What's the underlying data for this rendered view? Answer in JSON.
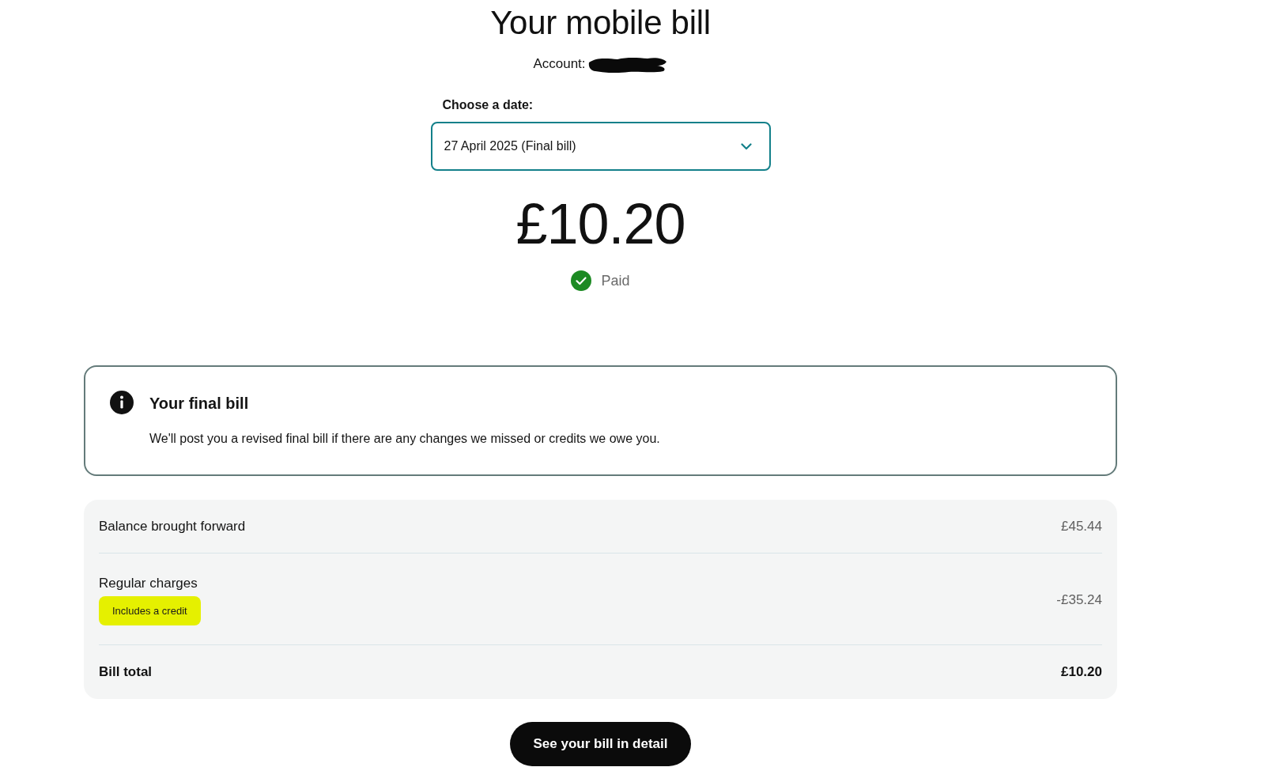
{
  "header": {
    "title": "Your mobile bill",
    "account_label": "Account:",
    "account_redacted": true
  },
  "date_picker": {
    "label": "Choose a date:",
    "value": "27 April 2025 (Final bill)"
  },
  "bill": {
    "amount": "£10.20",
    "status": {
      "label": "Paid",
      "paid": true
    }
  },
  "notice": {
    "title": "Your final bill",
    "body": "We'll post you a revised final bill if there are any changes we missed or credits we owe you."
  },
  "summary": {
    "rows": [
      {
        "kind": "line",
        "label": "Balance brought forward",
        "amount": "£45.44"
      },
      {
        "kind": "line",
        "label": "Regular charges",
        "badge": "Includes a credit",
        "amount": "-£35.24"
      },
      {
        "kind": "total",
        "label": "Bill total",
        "amount": "£10.20"
      }
    ]
  },
  "buttons": [
    {
      "label": "See your bill in detail"
    }
  ]
}
